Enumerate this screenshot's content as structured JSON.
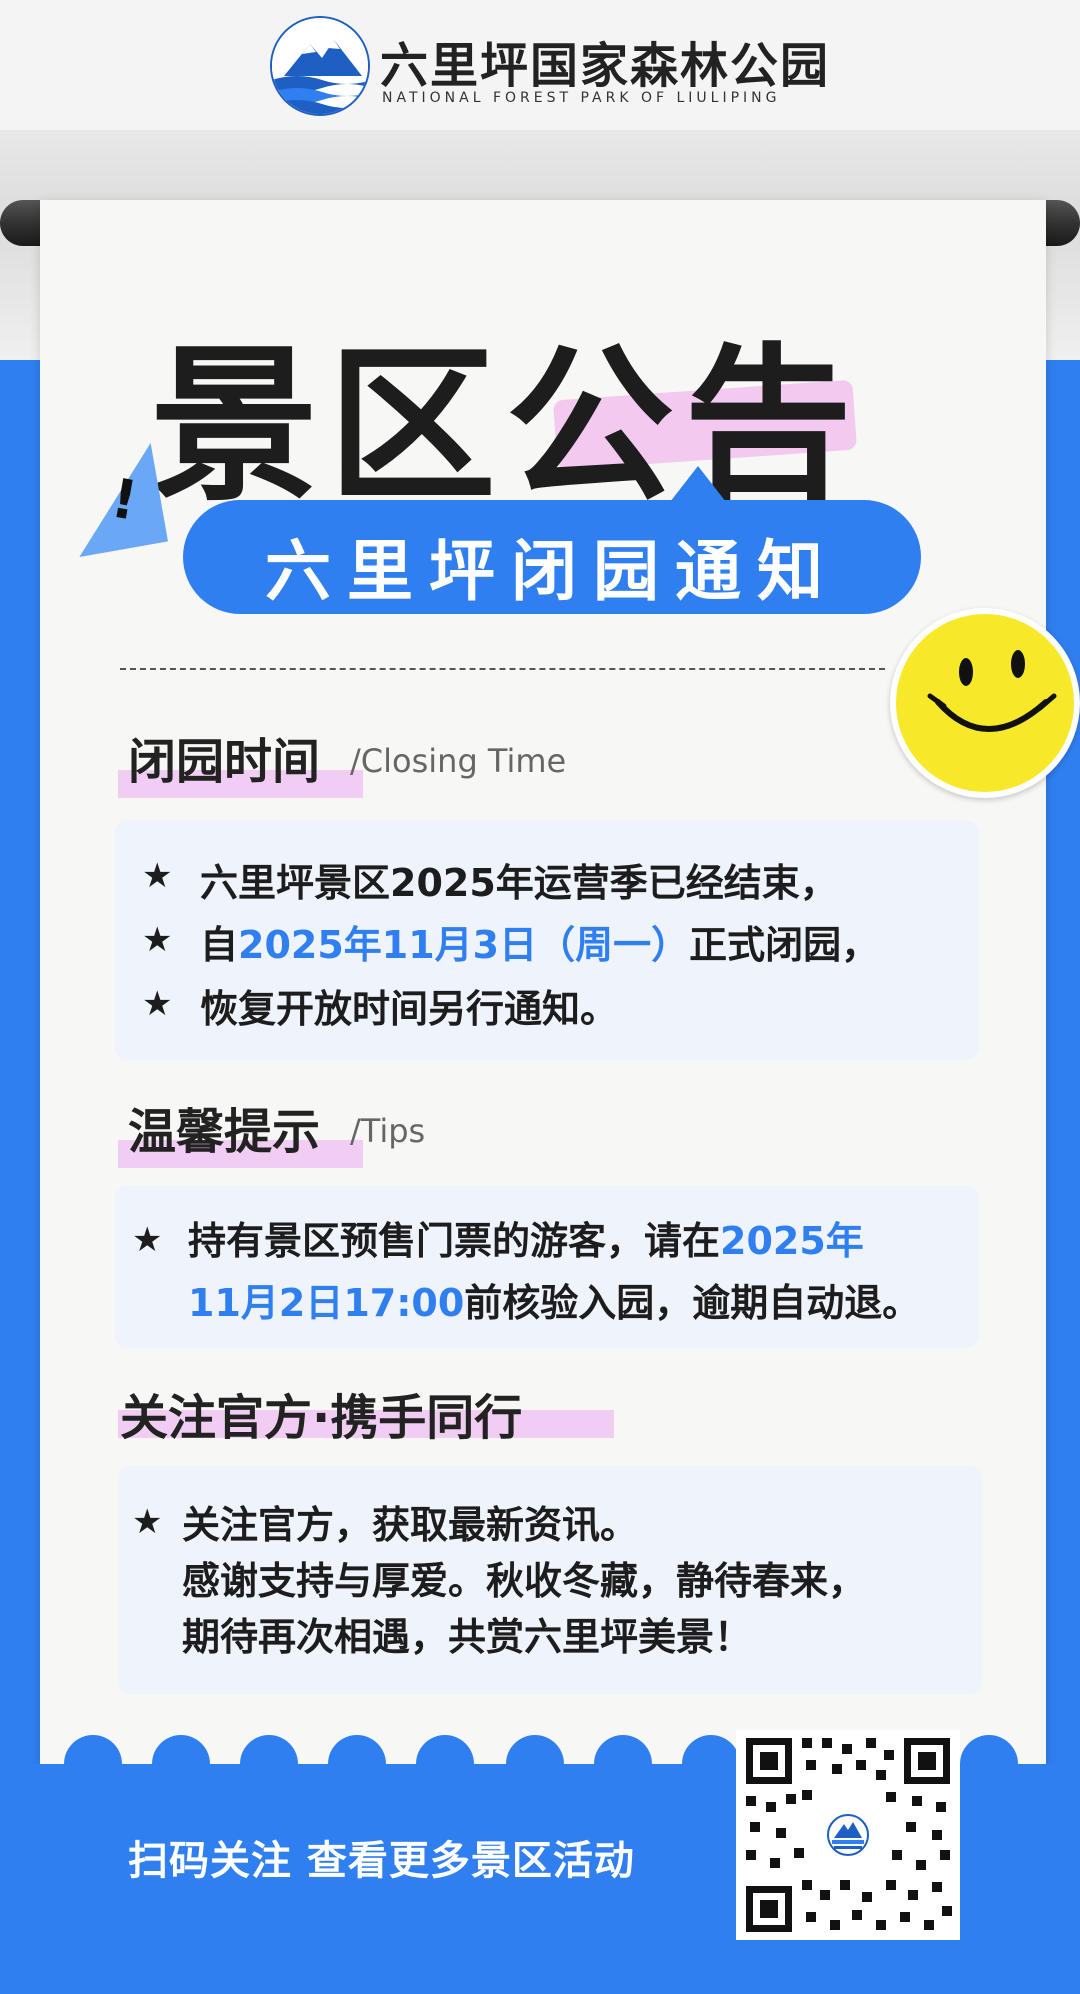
{
  "header": {
    "logo_name": "六里坪国家森林公园",
    "logo_sub": "NATIONAL FOREST PARK OF LIULIPING"
  },
  "title": {
    "main": "景区公告",
    "subtitle": "六里坪闭园通知",
    "warning_mark": "!"
  },
  "sections": {
    "closing": {
      "title": "闭园时间",
      "subtitle": "/Closing Time",
      "lines": [
        {
          "pre": "六里坪景区2025年运营季已经结束，",
          "highlight": "",
          "post": ""
        },
        {
          "pre": "自",
          "highlight": "2025年11月3日（周一）",
          "post": "正式闭园，"
        },
        {
          "pre": "恢复开放时间另行通知。",
          "highlight": "",
          "post": ""
        }
      ]
    },
    "tips": {
      "title": "温馨提示",
      "subtitle": "/Tips",
      "line1_pre": "持有景区预售门票的游客，请在",
      "line1_highlight": "2025年",
      "line2_highlight": "11月2日17:00",
      "line2_post": "前核验入园，逾期自动退。"
    },
    "follow": {
      "title": "关注官方·携手同行",
      "lines": [
        "关注官方，获取最新资讯。",
        "感谢支持与厚爱。秋收冬藏，静待春来，",
        "期待再次相遇，共赏六里坪美景！"
      ]
    }
  },
  "footer": {
    "cta": "扫码关注 查看更多景区活动"
  },
  "colors": {
    "accent": "#2f7ff0",
    "highlight_pink": "#f1cdf3",
    "card_bg": "#eef3fc",
    "smiley": "#f7e92a"
  },
  "icons": {
    "bullet": "star-icon",
    "warning": "warning-triangle-icon",
    "smiley": "smiley-face-icon",
    "qr": "qr-code-icon"
  }
}
